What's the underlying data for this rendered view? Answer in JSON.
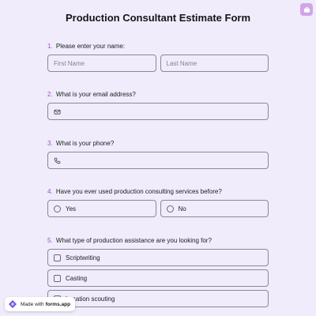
{
  "title": "Production Consultant Estimate Form",
  "questions": {
    "q1": {
      "num": "1.",
      "label": "Please enter your name:",
      "first_placeholder": "First Name",
      "last_placeholder": "Last Name"
    },
    "q2": {
      "num": "2.",
      "label": "What is your email address?",
      "icon": "mail-icon"
    },
    "q3": {
      "num": "3.",
      "label": "What is your phone?",
      "icon": "phone-icon"
    },
    "q4": {
      "num": "4.",
      "label": "Have you ever used production consulting services before?",
      "options": [
        "Yes",
        "No"
      ]
    },
    "q5": {
      "num": "5.",
      "label": "What type of production assistance are you looking for?",
      "options": [
        "Scriptwriting",
        "Casting",
        "Location scouting"
      ]
    }
  },
  "badge": {
    "prefix": "Made with",
    "brand": "forms.app"
  },
  "colors": {
    "background": "#f0ecfb",
    "accent": "#a04bc4",
    "corner_button": "#d0a6e8"
  },
  "icons": {
    "corner": "briefcase-icon",
    "badge": "forms-app-logo-icon"
  }
}
